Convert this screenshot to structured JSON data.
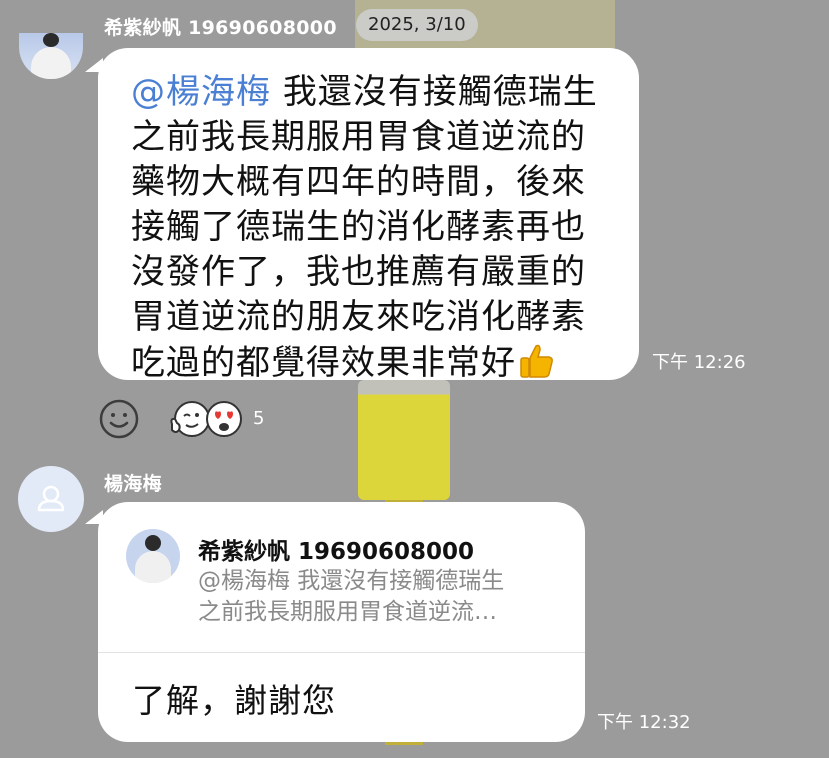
{
  "colors": {
    "mention": "#4a7fd4",
    "bubble": "#ffffff",
    "background": "#9b9b9b"
  },
  "date_pill": "2025, 3/10",
  "messages": [
    {
      "sender": "希紫紗帆 19690608000",
      "mention": "@楊海梅",
      "lines": [
        "我還沒有接觸德瑞生",
        "之前我長期服用胃食道逆流的",
        "藥物大概有四年的時間，後來",
        "接觸了德瑞生的消化酵素再也",
        "沒發作了，我也推薦有嚴重的",
        "胃道逆流的朋友來吃消化酵素",
        "吃過的都覺得效果非常好"
      ],
      "emoji_icon": "thumbs-up-icon",
      "time": "下午 12:26",
      "reactions": {
        "icons": [
          "smiley-add-icon",
          "wink-thumbs-up-icon",
          "heart-eyes-icon"
        ],
        "count": "5"
      }
    },
    {
      "sender": "楊海梅",
      "reply": {
        "name": "希紫紗帆 19690608000",
        "preview_line1": "@楊海梅 我還沒有接觸德瑞生",
        "preview_line2": "之前我長期服用胃食道逆流…"
      },
      "text": "了解，謝謝您",
      "time": "下午 12:32"
    }
  ]
}
